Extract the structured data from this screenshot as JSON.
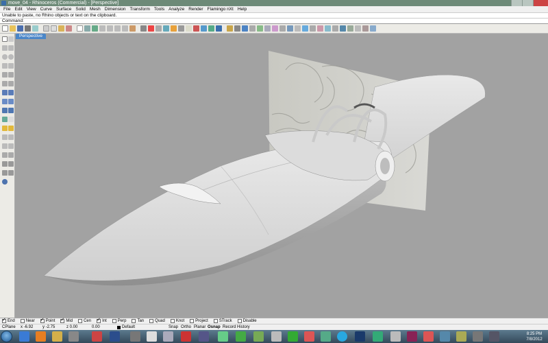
{
  "window": {
    "title": "move_04 - Rhinoceros (Commercial) - [Perspective]"
  },
  "menu": [
    "File",
    "Edit",
    "View",
    "Curve",
    "Surface",
    "Solid",
    "Mesh",
    "Dimension",
    "Transform",
    "Tools",
    "Analyze",
    "Render",
    "Flamingo nXt",
    "Help"
  ],
  "command_history": "Unable to paste, no Rhino objects or text on the clipboard.",
  "command_prompt": {
    "label": "Command:",
    "value": ""
  },
  "viewport": {
    "tab_label": "Perspective"
  },
  "osnap": [
    {
      "label": "End",
      "checked": true
    },
    {
      "label": "Near",
      "checked": false
    },
    {
      "label": "Point",
      "checked": true
    },
    {
      "label": "Mid",
      "checked": true
    },
    {
      "label": "Cen",
      "checked": false
    },
    {
      "label": "Int",
      "checked": true
    },
    {
      "label": "Perp",
      "checked": false
    },
    {
      "label": "Tan",
      "checked": false
    },
    {
      "label": "Quad",
      "checked": false
    },
    {
      "label": "Knot",
      "checked": false
    },
    {
      "label": "Project",
      "checked": false
    },
    {
      "label": "STrack",
      "checked": false
    },
    {
      "label": "Disable",
      "checked": false
    }
  ],
  "status": {
    "cplane": "CPlane",
    "x": "x -6.92",
    "y": "y -2.75",
    "z": "z 0.00",
    "extra": "0.00",
    "layer": "Default",
    "snap": "Snap",
    "ortho": "Ortho",
    "planar": "Planar",
    "osnap": "Osnap",
    "record_history": "Record History"
  },
  "tray": {
    "time": "8:25 PM",
    "date": "7/8/2012"
  },
  "colors": {
    "title_bar": "#6d8a78",
    "tab_active": "#4a86c8",
    "viewport_bg": "#a2a2a2",
    "taskbar": "#34495a"
  }
}
